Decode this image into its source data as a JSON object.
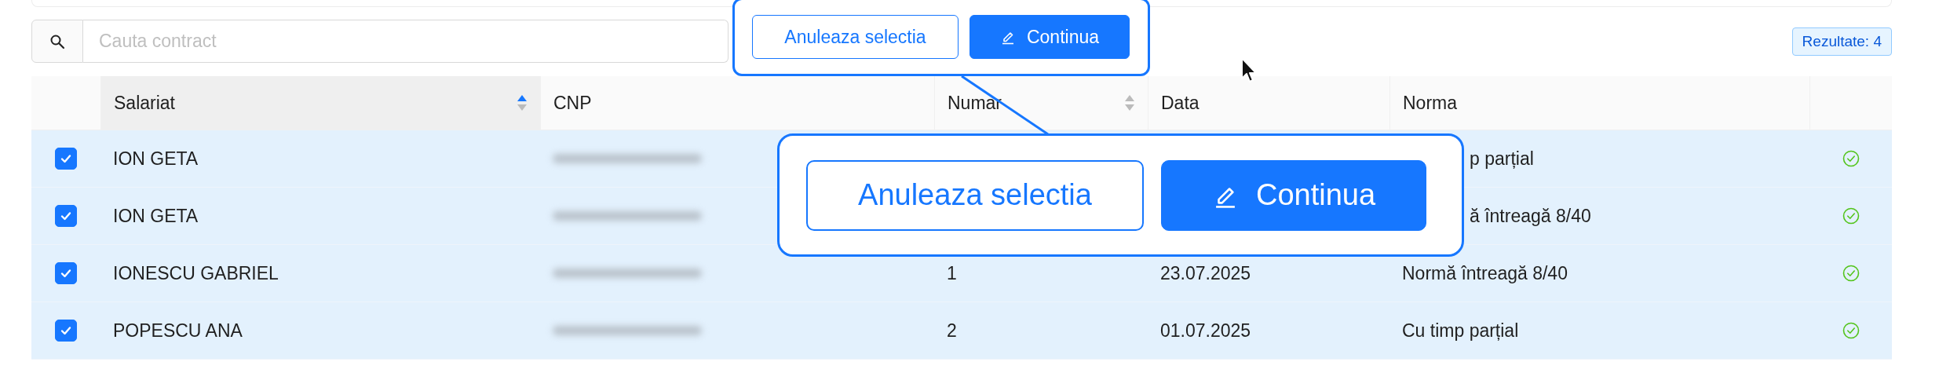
{
  "search": {
    "placeholder": "Cauta contract"
  },
  "results_badge": "Rezultate: 4",
  "actions": {
    "buttons": [
      {
        "label": "Anuleaza selectia",
        "kind": "outline"
      },
      {
        "label": "Continua",
        "kind": "primary"
      }
    ]
  },
  "zoom_callout": {
    "buttons": [
      {
        "label": "Anuleaza selectia",
        "kind": "outline"
      },
      {
        "label": "Continua",
        "kind": "primary"
      }
    ]
  },
  "table": {
    "columns": [
      {
        "label": "Salariat",
        "kind": "sortable",
        "sorted": true
      },
      {
        "label": "CNP",
        "kind": "plain"
      },
      {
        "label": "Numar",
        "kind": "sortable",
        "sorted": false
      },
      {
        "label": "Data",
        "kind": "plain"
      },
      {
        "label": "Norma",
        "kind": "plain"
      }
    ],
    "rows": [
      {
        "checked": true,
        "salariat": "ION GETA",
        "norma": "p parțial",
        "norma_covered": true,
        "valid": true
      },
      {
        "checked": true,
        "salariat": "ION GETA",
        "norma": "ă întreagă 8/40",
        "norma_covered": true,
        "valid": true
      },
      {
        "checked": true,
        "salariat": "IONESCU GABRIEL",
        "numar": "1",
        "data": "23.07.2025",
        "norma": "Normă întreagă 8/40",
        "norma_covered": false,
        "valid": true
      },
      {
        "checked": true,
        "salariat": "POPESCU ANA",
        "numar": "2",
        "data": "01.07.2025",
        "norma": "Cu timp parțial",
        "norma_covered": false,
        "valid": true
      }
    ]
  }
}
